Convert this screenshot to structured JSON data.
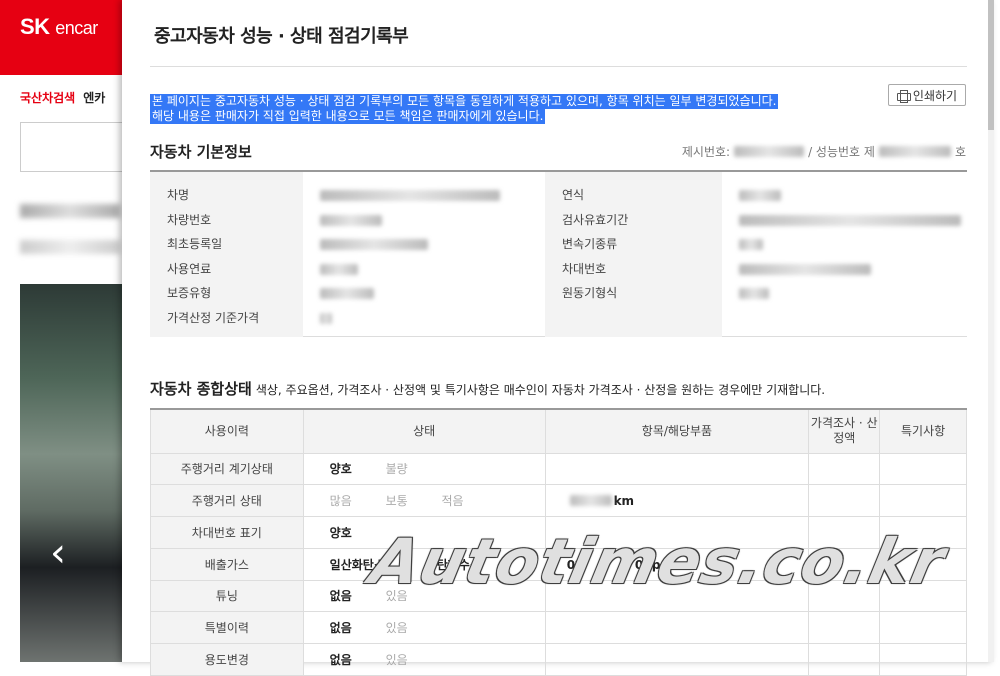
{
  "background_site": {
    "brand_sk": "SK",
    "brand_encar": "encar",
    "nav": [
      "국산차검색",
      "엔카"
    ]
  },
  "modal": {
    "title": "중고자동차 성능 · 상태 점검기록부",
    "notice_line1": "본 페이지는 중고자동차 성능 · 상태 점검 기록부의 모든 항목을 동일하게 적용하고 있으며, 항목 위치는 일부 변경되었습니다.",
    "notice_line2": "해당 내용은 판매자가 직접 입력한 내용으로 모든 책임은 판매자에게 있습니다.",
    "print_label": "인쇄하기",
    "basic_info": {
      "title": "자동차 기본정보",
      "meta_prefix": "제시번호:",
      "meta_mid": "/ 성능번호 제",
      "meta_suffix": "호",
      "left_labels": [
        "차명",
        "차량번호",
        "최초등록일",
        "사용연료",
        "보증유형",
        "가격산정 기준가격"
      ],
      "right_labels": [
        "연식",
        "검사유효기간",
        "변속기종류",
        "차대번호",
        "원동기형식"
      ]
    },
    "overall": {
      "title": "자동차 종합상태",
      "subtitle": "색상, 주요옵션, 가격조사 · 산정액 및 특기사항은 매수인이 자동차 가격조사 · 산정을 원하는 경우에만 기재합니다.",
      "headers": [
        "사용이력",
        "상태",
        "항목/해당부품",
        "가격조사 · 산정액",
        "특기사항"
      ],
      "rows": [
        {
          "label": "주행거리 계기상태",
          "options": [
            {
              "text": "양호",
              "on": true
            },
            {
              "text": "불량",
              "on": false
            }
          ]
        },
        {
          "label": "주행거리 상태",
          "options": [
            {
              "text": "많음",
              "on": false
            },
            {
              "text": "보통",
              "on": false
            },
            {
              "text": "적음",
              "on": false
            }
          ],
          "unit": "km"
        },
        {
          "label": "차대번호 표기",
          "options": [
            {
              "text": "양호",
              "on": true
            }
          ]
        },
        {
          "label": "배출가스",
          "options": [
            {
              "text": "일산화탄소",
              "on": true
            },
            {
              "text": "탄화수소",
              "on": true
            },
            {
              "text": "0%",
              "on": true
            },
            {
              "text": "0ppm",
              "on": true
            }
          ]
        },
        {
          "label": "튜닝",
          "options": [
            {
              "text": "없음",
              "on": true
            },
            {
              "text": "있음",
              "on": false
            }
          ]
        },
        {
          "label": "특별이력",
          "options": [
            {
              "text": "없음",
              "on": true
            },
            {
              "text": "있음",
              "on": false
            }
          ]
        },
        {
          "label": "용도변경",
          "options": [
            {
              "text": "없음",
              "on": true
            },
            {
              "text": "있음",
              "on": false
            }
          ]
        }
      ]
    }
  },
  "watermark": "Autotimes.co.kr",
  "colors": {
    "brand_red": "#e60012",
    "selection_blue": "#3478f6"
  }
}
